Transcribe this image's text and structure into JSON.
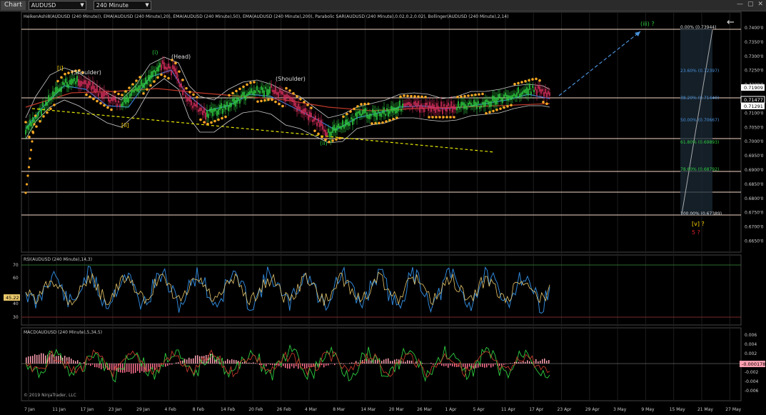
{
  "toolbar": {
    "chart_tab": "Chart",
    "instrument": "AUDUSD",
    "interval": "240 Minute"
  },
  "price_panel": {
    "indicators_label": "HeikenAshi8(AUDUSD (240 Minute)), EMA(AUDUSD (240 Minute),20), EMA(AUDUSD (240 Minute),50), EMA(AUDUSD (240 Minute),200), Parabolic SAR(AUDUSD (240 Minute),0.02,0.2,0.02), Bollinger(AUDUSD (240 Minute),2,14)",
    "y_ticks": [
      "0.7400'0",
      "0.7350'0",
      "0.7300'0",
      "0.7250'0",
      "0.7200'0",
      "0.7150'0",
      "0.7100'0",
      "0.7050'0",
      "0.7000'0",
      "0.6950'0",
      "0.6900'0",
      "0.6850'0",
      "0.6800'0",
      "0.6750'0",
      "0.6700'0",
      "0.6650'0"
    ],
    "price_tags": [
      {
        "text": "0.71909",
        "bg": "#ffffff",
        "fg": "#000000"
      },
      {
        "text": "0.71477",
        "bg": "#000000",
        "fg": "#ffffff"
      },
      {
        "text": "0.71291",
        "bg": "#ffffff",
        "fg": "#000000"
      }
    ],
    "fib_levels": [
      "0.00% (0.73944)",
      "23.60% (0.72397)",
      "38.20% (0.71440)",
      "50.00% (0.70667)",
      "61.80% (0.69893)",
      "78.60% (0.68792)",
      "100.00% (0.67389)"
    ],
    "wave_labels": [
      {
        "text": "[i]",
        "color": "#ffd700"
      },
      {
        "text": "(Shoulder)",
        "color": "#dddddd"
      },
      {
        "text": "(i)",
        "color": "#2ecc40"
      },
      {
        "text": "(Head)",
        "color": "#dddddd"
      },
      {
        "text": "(Shoulder)",
        "color": "#dddddd"
      },
      {
        "text": "[ii]",
        "color": "#ffd700"
      },
      {
        "text": "(ii) ?",
        "color": "#2ecc40"
      },
      {
        "text": "(iii) ?",
        "color": "#2ecc40"
      },
      {
        "text": "[v] ?",
        "color": "#ffd700"
      },
      {
        "text": "5 ?",
        "color": "#e0202a"
      }
    ]
  },
  "rsi_panel": {
    "label": "RSI(AUDUSD (240 Minute),14,3)",
    "y_ticks": [
      "70",
      "60",
      "50",
      "40",
      "30"
    ],
    "current_value": "45.22"
  },
  "macd_panel": {
    "label": "MACD(AUDUSD (240 Minute),5,34,5)",
    "y_ticks": [
      "0.006",
      "0.004",
      "0.002",
      "0",
      "-0.002",
      "-0.004",
      "-0.006"
    ],
    "current_value": "-0.000178",
    "copyright": "© 2019 NinjaTrader, LLC"
  },
  "x_axis": {
    "dates": [
      "7 Jan",
      "11 Jan",
      "17 Jan",
      "23 Jan",
      "29 Jan",
      "4 Feb",
      "8 Feb",
      "14 Feb",
      "20 Feb",
      "26 Feb",
      "4 Mar",
      "8 Mar",
      "14 Mar",
      "20 Mar",
      "26 Mar",
      "1 Apr",
      "5 Apr",
      "11 Apr",
      "17 Apr",
      "23 Apr",
      "29 Apr",
      "3 May",
      "9 May",
      "15 May",
      "21 May",
      "27 May"
    ]
  },
  "colors": {
    "background": "#000000",
    "sar_dots": "#f5a623",
    "ema_fast": "#3a7bd5",
    "ema_slow": "#c0392b",
    "trendline": "#e6e600",
    "projection": "#4a90d9",
    "horizontal_lines": "#f3d9c7",
    "rsi_line": "#2f86d6",
    "macd_up": "#ff9fb0"
  }
}
